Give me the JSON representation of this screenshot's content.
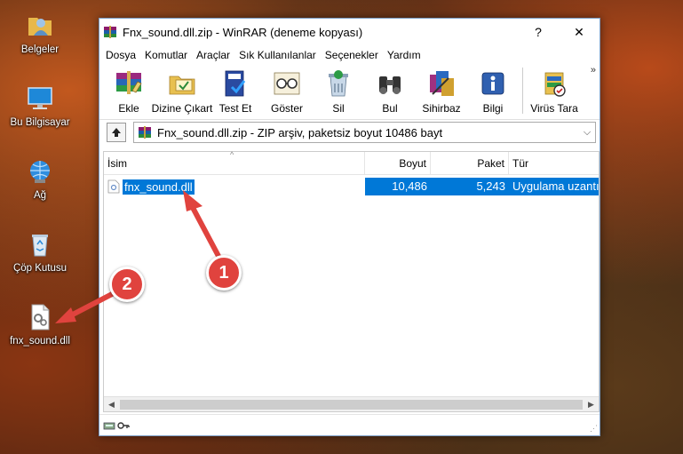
{
  "desktop": {
    "icons": [
      {
        "label": "Belgeler",
        "icon": "user-folder-icon"
      },
      {
        "label": "Bu Bilgisayar",
        "icon": "computer-icon"
      },
      {
        "label": "Ağ",
        "icon": "network-icon"
      },
      {
        "label": "Çöp Kutusu",
        "icon": "recycle-bin-icon"
      },
      {
        "label": "fnx_sound.dll",
        "icon": "dll-file-icon"
      }
    ]
  },
  "window": {
    "title": "Fnx_sound.dll.zip - WinRAR (deneme kopyası)",
    "help": "?",
    "close": "✕"
  },
  "menu": [
    "Dosya",
    "Komutlar",
    "Araçlar",
    "Sık Kullanılanlar",
    "Seçenekler",
    "Yardım"
  ],
  "toolbar": {
    "items": [
      {
        "label": "Ekle",
        "icon": "add-books-icon"
      },
      {
        "label": "Dizine Çıkart",
        "icon": "extract-folder-icon"
      },
      {
        "label": "Test Et",
        "icon": "test-icon"
      },
      {
        "label": "Göster",
        "icon": "view-glasses-icon"
      },
      {
        "label": "Sil",
        "icon": "delete-icon"
      },
      {
        "label": "Bul",
        "icon": "find-binoculars-icon"
      },
      {
        "label": "Sihirbaz",
        "icon": "wizard-icon"
      },
      {
        "label": "Bilgi",
        "icon": "info-icon"
      },
      {
        "label": "Virüs Tara",
        "icon": "virus-scan-icon"
      }
    ],
    "more": "»"
  },
  "pathbar": {
    "path": "Fnx_sound.dll.zip - ZIP arşiv, paketsiz boyut 10486 bayt"
  },
  "columns": {
    "name": "İsim",
    "size": "Boyut",
    "packed": "Paket",
    "type": "Tür"
  },
  "files": [
    {
      "name": "fnx_sound.dll",
      "size": "10,486",
      "packed": "5,243",
      "type": "Uygulama uzantısı"
    }
  ],
  "markers": {
    "one": "1",
    "two": "2"
  },
  "colors": {
    "selection": "#0078d7",
    "marker": "#e0433e"
  }
}
